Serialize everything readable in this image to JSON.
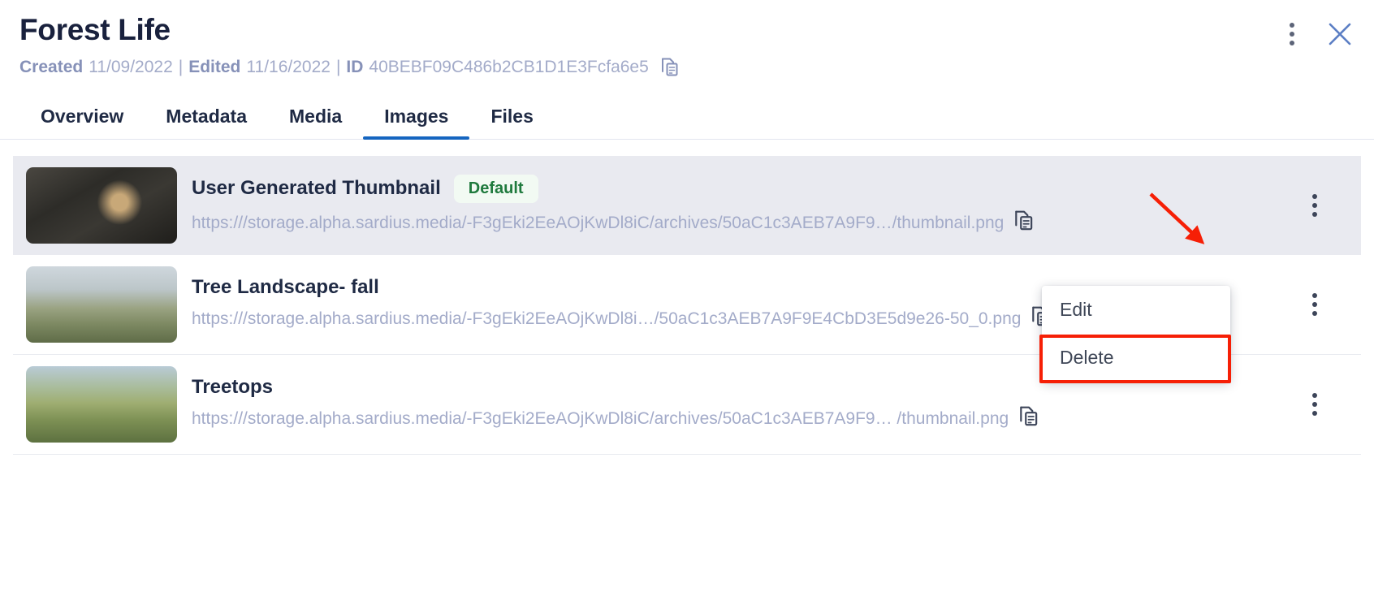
{
  "header": {
    "title": "Forest Life",
    "created_label": "Created",
    "created_value": "11/09/2022",
    "edited_label": "Edited",
    "edited_value": "11/16/2022",
    "id_label": "ID",
    "id_value": "40BEBF09C486b2CB1D1E3Fcfa6e5",
    "separator": "|",
    "copy_icon": "copy-icon",
    "more_icon": "kebab-menu-icon",
    "close_icon": "close-icon"
  },
  "tabs": [
    {
      "label": "Overview",
      "active": false
    },
    {
      "label": "Metadata",
      "active": false
    },
    {
      "label": "Media",
      "active": false
    },
    {
      "label": "Images",
      "active": true
    },
    {
      "label": "Files",
      "active": false
    }
  ],
  "images": [
    {
      "title": "User Generated Thumbnail",
      "badge": "Default",
      "url": "https:///storage.alpha.sardius.media/-F3gEki2EeAOjKwDl8iC/archives/50aC1c3AEB7A9F9…/thumbnail.png",
      "copy_icon": "copy-icon",
      "more_icon": "kebab-menu-icon",
      "selected": true
    },
    {
      "title": "Tree Landscape- fall",
      "badge": "",
      "url": "https:///storage.alpha.sardius.media/-F3gEki2EeAOjKwDl8i…/50aC1c3AEB7A9F9E4CbD3E5d9e26-50_0.png",
      "copy_icon": "copy-icon",
      "more_icon": "kebab-menu-icon",
      "selected": false
    },
    {
      "title": "Treetops",
      "badge": "",
      "url": "https:///storage.alpha.sardius.media/-F3gEki2EeAOjKwDl8iC/archives/50aC1c3AEB7A9F9…  /thumbnail.png",
      "copy_icon": "copy-icon",
      "more_icon": "kebab-menu-icon",
      "selected": false
    }
  ],
  "dropdown": {
    "items": [
      {
        "label": "Edit"
      },
      {
        "label": "Delete"
      }
    ]
  },
  "annotations": {
    "arrow_color": "#f61f06",
    "highlight_color": "#f61f06",
    "highlight_target": "Delete"
  },
  "colors": {
    "accent": "#1565c0",
    "title_text": "#1f2a44",
    "muted_text": "#a3abc9",
    "badge_bg": "#f2faf3",
    "badge_text": "#1f7a3d",
    "selected_row_bg": "#e9eaf0"
  }
}
